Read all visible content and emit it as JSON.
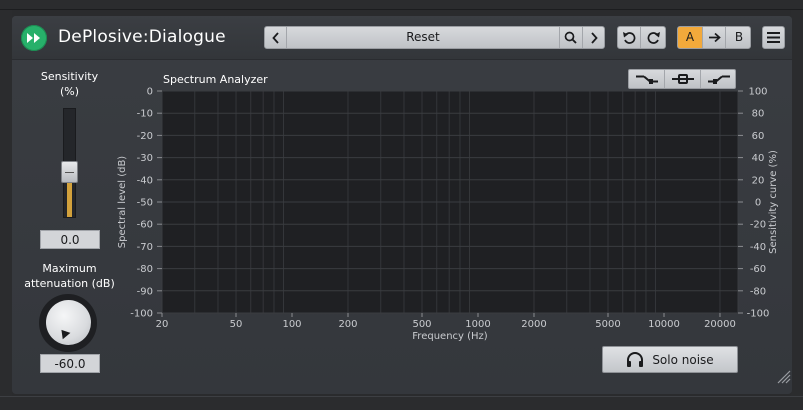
{
  "plugin": {
    "title": "DePlosive:Dialogue",
    "accent_color": "#27b06a"
  },
  "header": {
    "preset_name": "Reset",
    "ab": {
      "a_label": "A",
      "b_label": "B",
      "active": "A",
      "active_color": "#f2a93b"
    }
  },
  "controls": {
    "sensitivity": {
      "label_line1": "Sensitivity",
      "label_line2": "(%)",
      "value": "0.0",
      "slider_fraction": 0.42
    },
    "max_attenuation": {
      "label_line1": "Maximum",
      "label_line2": "attenuation (dB)",
      "value": "-60.0"
    }
  },
  "analyzer": {
    "title": "Spectrum Analyzer",
    "left_axis_label": "Spectral level (dB)",
    "right_axis_label": "Sensitivity curve (%)",
    "x_axis_label": "Frequency (Hz)",
    "left_ticks": [
      "0",
      "-10",
      "-20",
      "-30",
      "-40",
      "-50",
      "-60",
      "-70",
      "-80",
      "-90",
      "-100"
    ],
    "right_ticks": [
      "100",
      "80",
      "60",
      "40",
      "20",
      "0",
      "-20",
      "-40",
      "-60",
      "-80",
      "-100"
    ],
    "x_ticks": [
      "20",
      "50",
      "100",
      "200",
      "500",
      "1000",
      "2000",
      "5000",
      "10000",
      "20000"
    ],
    "x_tick_values": [
      20,
      50,
      100,
      200,
      500,
      1000,
      2000,
      5000,
      10000,
      20000
    ],
    "x_range": [
      20,
      25000
    ],
    "scale": "log",
    "grid": true
  },
  "solo_button": {
    "label": "Solo noise"
  }
}
